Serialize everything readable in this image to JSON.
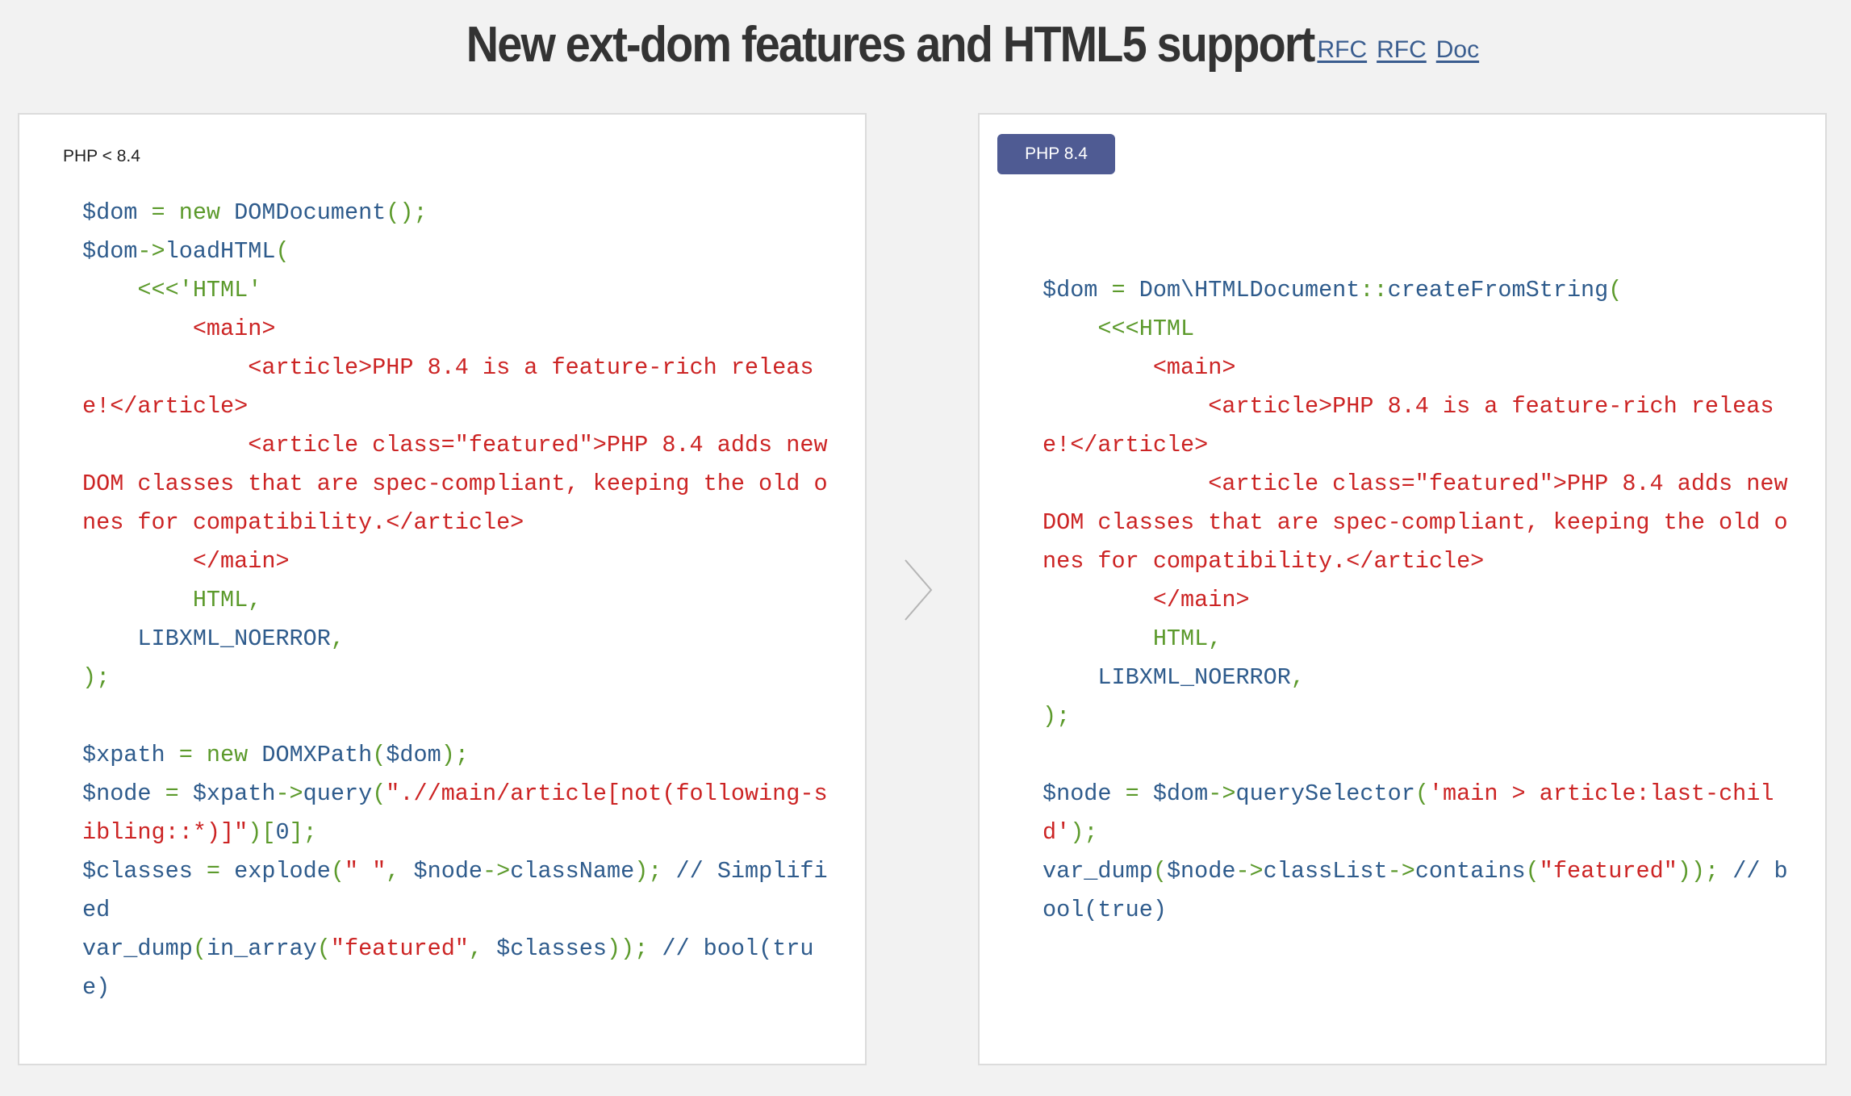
{
  "header": {
    "title": "New ext-dom features and HTML5 support",
    "links": [
      "RFC",
      "RFC",
      "Doc"
    ]
  },
  "colors": {
    "variable": "#2e5b8c",
    "keyword": "#5c9a2c",
    "string": "#cc2424",
    "badge_bg": "#4f5b93"
  },
  "panels": {
    "old": {
      "version_label": "PHP < 8.4",
      "tokens": [
        [
          "v",
          "$dom"
        ],
        [
          "k",
          " = new "
        ],
        [
          "v",
          "DOMDocument"
        ],
        [
          "k",
          "();\n"
        ],
        [
          "v",
          "$dom"
        ],
        [
          "k",
          "->"
        ],
        [
          "v",
          "loadHTML"
        ],
        [
          "k",
          "(\n    <<<'HTML'\n"
        ],
        [
          "s",
          "        <main>\n            <article>PHP 8.4 is a feature-rich release!</article>\n            <article class=\"featured\">PHP 8.4 adds new DOM classes that are spec-compliant, keeping the old ones for compatibility.</article>\n        </main>\n"
        ],
        [
          "k",
          "        HTML,\n    "
        ],
        [
          "v",
          "LIBXML_NOERROR"
        ],
        [
          "k",
          ",\n);\n\n"
        ],
        [
          "v",
          "$xpath"
        ],
        [
          "k",
          " = new "
        ],
        [
          "v",
          "DOMXPath"
        ],
        [
          "k",
          "("
        ],
        [
          "v",
          "$dom"
        ],
        [
          "k",
          ");\n"
        ],
        [
          "v",
          "$node"
        ],
        [
          "k",
          " = "
        ],
        [
          "v",
          "$xpath"
        ],
        [
          "k",
          "->"
        ],
        [
          "v",
          "query"
        ],
        [
          "k",
          "("
        ],
        [
          "s",
          "\".//main/article[not(following-sibling::*)]\""
        ],
        [
          "k",
          ")["
        ],
        [
          "v",
          "0"
        ],
        [
          "k",
          "];\n"
        ],
        [
          "v",
          "$classes"
        ],
        [
          "k",
          " = "
        ],
        [
          "v",
          "explode"
        ],
        [
          "k",
          "("
        ],
        [
          "s",
          "\" \""
        ],
        [
          "k",
          ", "
        ],
        [
          "v",
          "$node"
        ],
        [
          "k",
          "->"
        ],
        [
          "v",
          "className"
        ],
        [
          "k",
          ");"
        ],
        [
          "v",
          " // Simplified\n"
        ],
        [
          "v",
          "var_dump"
        ],
        [
          "k",
          "("
        ],
        [
          "v",
          "in_array"
        ],
        [
          "k",
          "("
        ],
        [
          "s",
          "\"featured\""
        ],
        [
          "k",
          ", "
        ],
        [
          "v",
          "$classes"
        ],
        [
          "k",
          "));"
        ],
        [
          "v",
          " // bool(true)"
        ]
      ]
    },
    "new": {
      "version_label": "PHP 8.4",
      "tokens": [
        [
          "v",
          "$dom"
        ],
        [
          "k",
          " = "
        ],
        [
          "v",
          "Dom\\HTMLDocument"
        ],
        [
          "k",
          "::"
        ],
        [
          "v",
          "createFromString"
        ],
        [
          "k",
          "(\n    <<<HTML\n"
        ],
        [
          "s",
          "        <main>\n            <article>PHP 8.4 is a feature-rich release!</article>\n            <article class=\"featured\">PHP 8.4 adds new DOM classes that are spec-compliant, keeping the old ones for compatibility.</article>\n        </main>\n"
        ],
        [
          "k",
          "        HTML,\n    "
        ],
        [
          "v",
          "LIBXML_NOERROR"
        ],
        [
          "k",
          ",\n);\n\n"
        ],
        [
          "v",
          "$node"
        ],
        [
          "k",
          " = "
        ],
        [
          "v",
          "$dom"
        ],
        [
          "k",
          "->"
        ],
        [
          "v",
          "querySelector"
        ],
        [
          "k",
          "("
        ],
        [
          "s",
          "'main > article:last-child'"
        ],
        [
          "k",
          ");\n"
        ],
        [
          "v",
          "var_dump"
        ],
        [
          "k",
          "("
        ],
        [
          "v",
          "$node"
        ],
        [
          "k",
          "->"
        ],
        [
          "v",
          "classList"
        ],
        [
          "k",
          "->"
        ],
        [
          "v",
          "contains"
        ],
        [
          "k",
          "("
        ],
        [
          "s",
          "\"featured\""
        ],
        [
          "k",
          "));"
        ],
        [
          "v",
          " // bool(true)"
        ]
      ]
    }
  },
  "icons": {
    "arrow": "chevron-right-icon"
  }
}
